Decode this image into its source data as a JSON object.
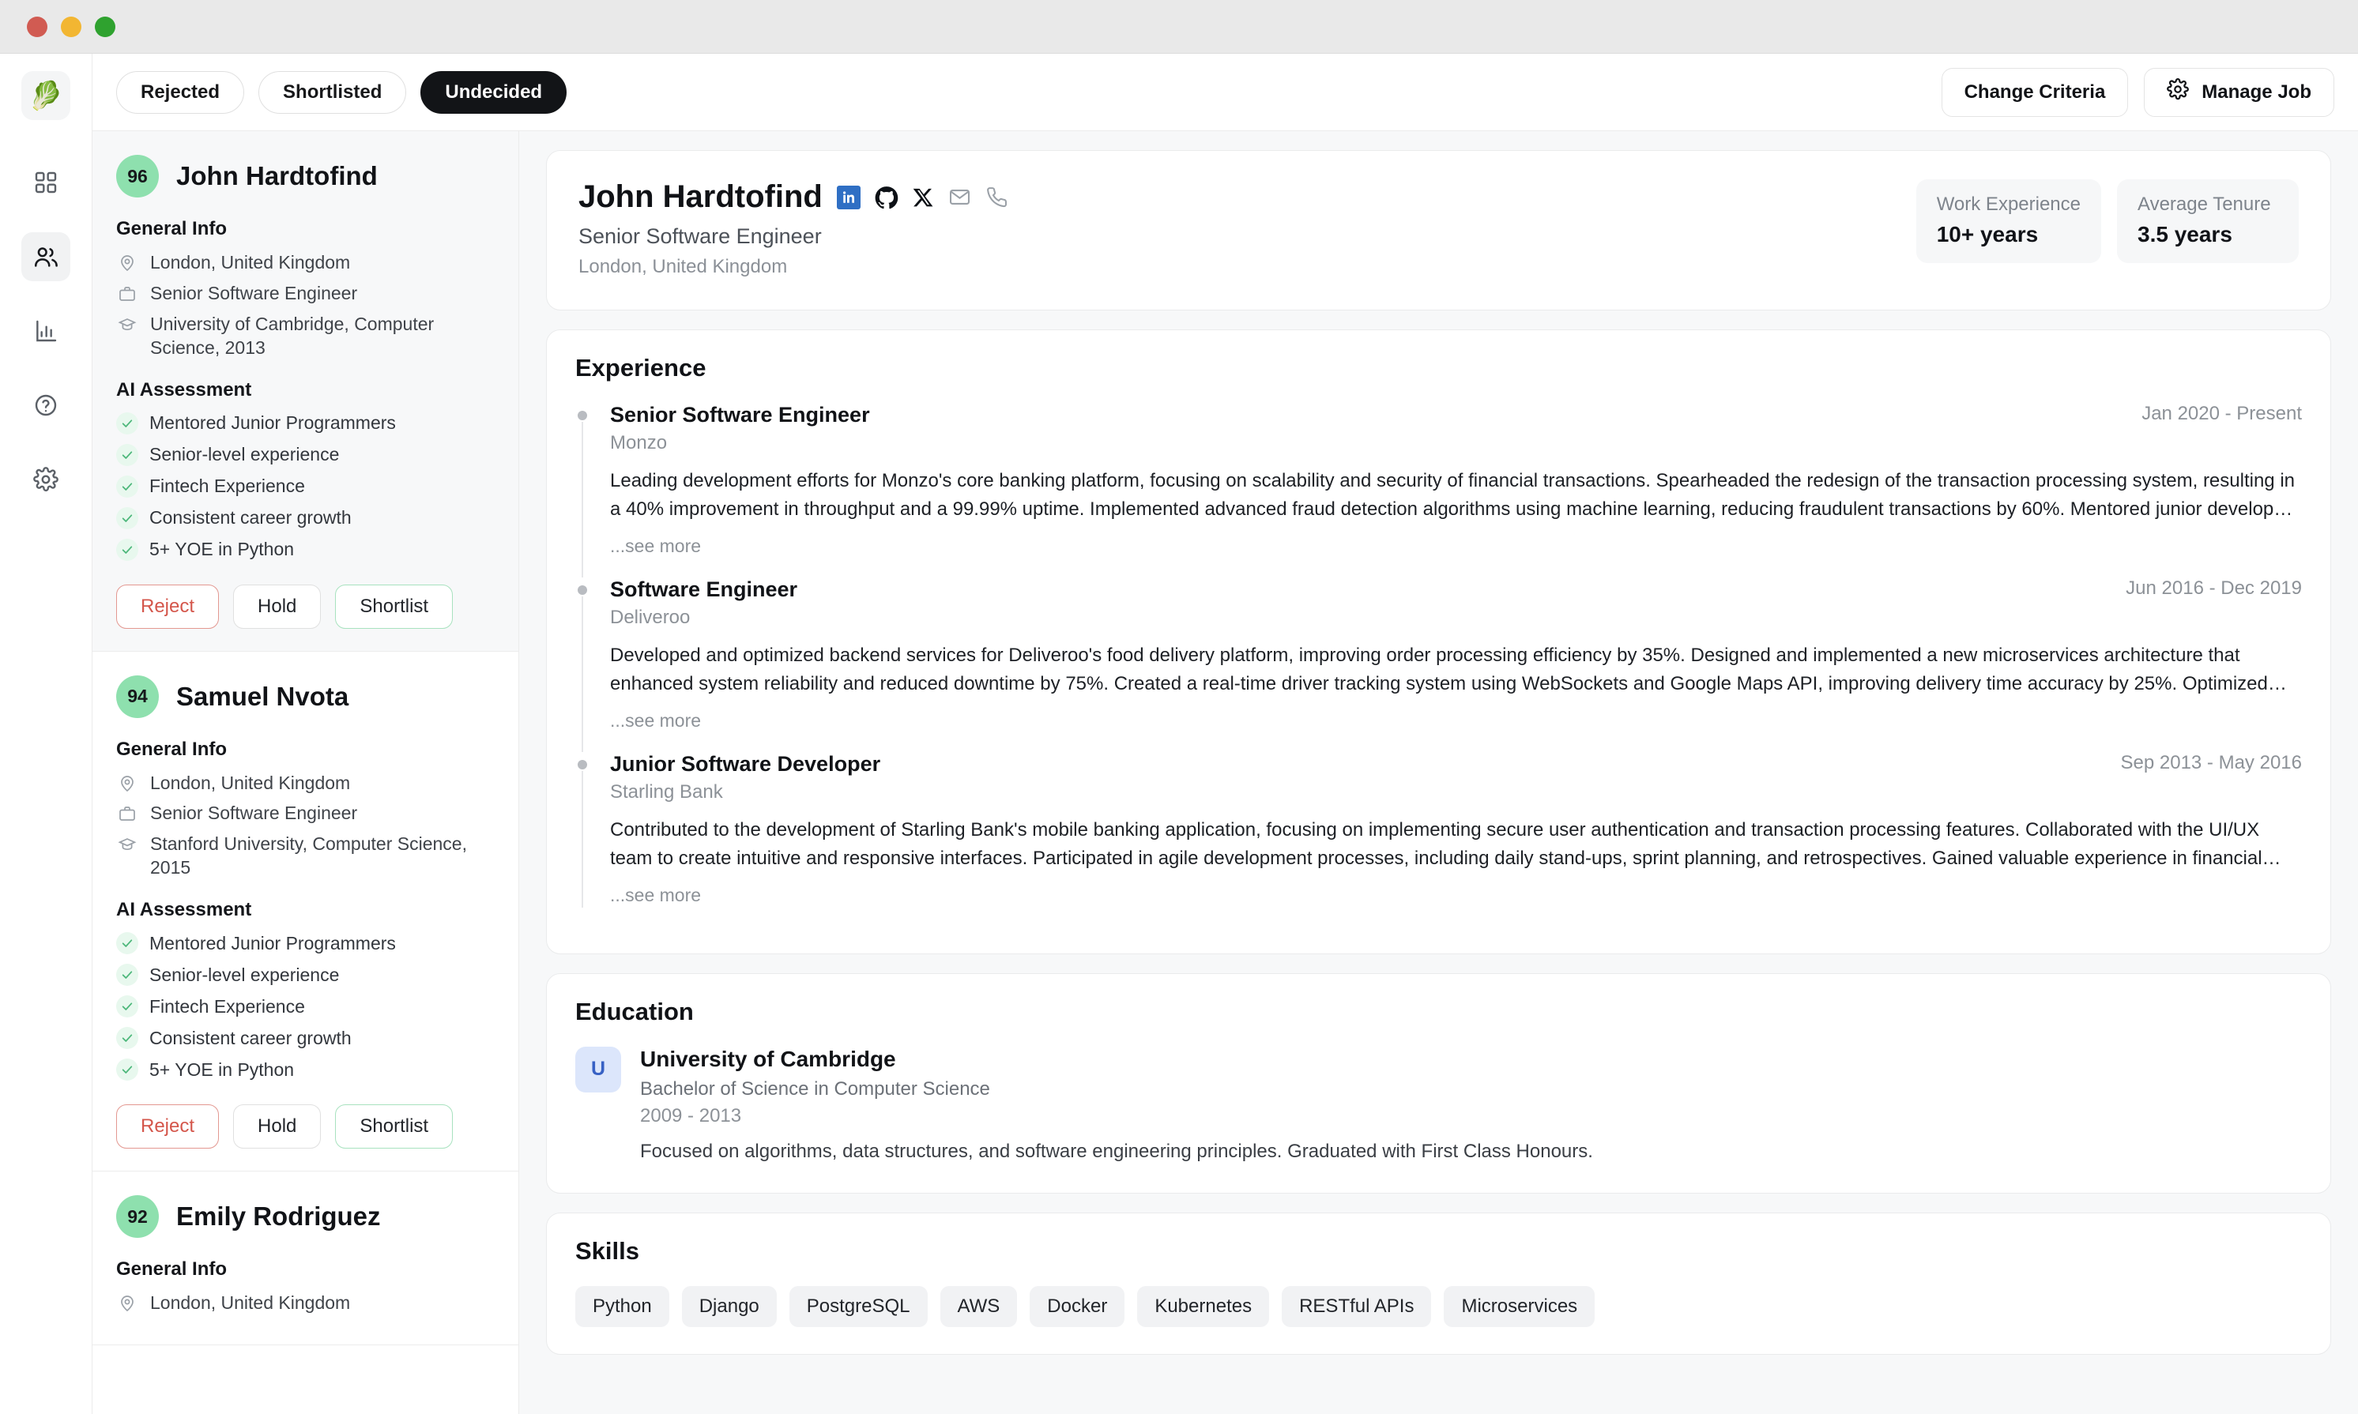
{
  "app": {
    "logo_icon": "leafy-green-emoji",
    "logo_glyph": "🥬"
  },
  "rail": {
    "items": [
      {
        "name": "dashboard",
        "icon": "grid-icon",
        "active": false
      },
      {
        "name": "candidates",
        "icon": "users-icon",
        "active": true
      },
      {
        "name": "analytics",
        "icon": "bar-chart-icon",
        "active": false
      },
      {
        "name": "help",
        "icon": "question-circle-icon",
        "active": false
      },
      {
        "name": "settings",
        "icon": "gear-icon",
        "active": false
      }
    ]
  },
  "topbar": {
    "segments": [
      {
        "label": "Rejected",
        "active": false
      },
      {
        "label": "Shortlisted",
        "active": false
      },
      {
        "label": "Undecided",
        "active": true
      }
    ],
    "change_criteria_label": "Change Criteria",
    "manage_job_label": "Manage Job",
    "manage_job_icon": "gear-icon"
  },
  "candidate_list": {
    "general_info_heading": "General Info",
    "ai_assessment_heading": "AI Assessment",
    "actions": {
      "reject": "Reject",
      "hold": "Hold",
      "shortlist": "Shortlist"
    },
    "candidates": [
      {
        "score": "96",
        "name": "John Hardtofind",
        "location": "London, United Kingdom",
        "title": "Senior Software Engineer",
        "education": "University of Cambridge, Computer Science, 2013",
        "assessment": [
          "Mentored Junior Programmers",
          "Senior-level experience",
          "Fintech Experience",
          "Consistent career growth",
          "5+ YOE in Python"
        ],
        "selected": true
      },
      {
        "score": "94",
        "name": "Samuel Nvota",
        "location": "London, United Kingdom",
        "title": "Senior Software Engineer",
        "education": "Stanford University, Computer Science, 2015",
        "assessment": [
          "Mentored Junior Programmers",
          "Senior-level experience",
          "Fintech Experience",
          "Consistent career growth",
          "5+ YOE in Python"
        ],
        "selected": false
      },
      {
        "score": "92",
        "name": "Emily Rodriguez",
        "location": "London, United Kingdom",
        "title": "",
        "education": "",
        "assessment": [],
        "selected": false
      }
    ]
  },
  "detail": {
    "name": "John Hardtofind",
    "role": "Senior Software Engineer",
    "location": "London, United Kingdom",
    "social": [
      {
        "name": "linkedin-icon"
      },
      {
        "name": "github-icon"
      },
      {
        "name": "x-icon"
      },
      {
        "name": "email-icon"
      },
      {
        "name": "phone-icon"
      }
    ],
    "stats": [
      {
        "label": "Work Experience",
        "value": "10+ years"
      },
      {
        "label": "Average Tenure",
        "value": "3.5 years"
      }
    ],
    "experience": {
      "heading": "Experience",
      "see_more_label": "...see more",
      "items": [
        {
          "title": "Senior Software Engineer",
          "company": "Monzo",
          "dates": "Jan 2020 - Present",
          "description": "Leading development efforts for Monzo's core banking platform, focusing on scalability and security of financial transactions. Spearheaded the redesign of the transaction processing system, resulting in a 40% improvement in throughput and a 99.99% uptime. Implemented advanced fraud detection algorithms using machine learning, reducing fraudulent transactions by 60%. Mentored junior developers a…"
        },
        {
          "title": "Software Engineer",
          "company": "Deliveroo",
          "dates": "Jun 2016 - Dec 2019",
          "description": "Developed and optimized backend services for Deliveroo's food delivery platform, improving order processing efficiency by 35%. Designed and implemented a new microservices architecture that enhanced system reliability and reduced downtime by 75%. Created a real-time driver tracking system using WebSockets and Google Maps API, improving delivery time accuracy by 25%. Optimized…"
        },
        {
          "title": "Junior Software Developer",
          "company": "Starling Bank",
          "dates": "Sep 2013 - May 2016",
          "description": "Contributed to the development of Starling Bank's mobile banking application, focusing on implementing secure user authentication and transaction processing features. Collaborated with the UI/UX team to create intuitive and responsive interfaces. Participated in agile development processes, including daily stand-ups, sprint planning, and retrospectives. Gained valuable experience in financial technolog…"
        }
      ]
    },
    "education": {
      "heading": "Education",
      "items": [
        {
          "avatar": "U",
          "school": "University of Cambridge",
          "degree": "Bachelor of Science in Computer Science",
          "years": "2009 - 2013",
          "description": "Focused on algorithms, data structures, and software engineering principles. Graduated with First Class Honours."
        }
      ]
    },
    "skills": {
      "heading": "Skills",
      "items": [
        "Python",
        "Django",
        "PostgreSQL",
        "AWS",
        "Docker",
        "Kubernetes",
        "RESTful APIs",
        "Microservices"
      ]
    }
  }
}
